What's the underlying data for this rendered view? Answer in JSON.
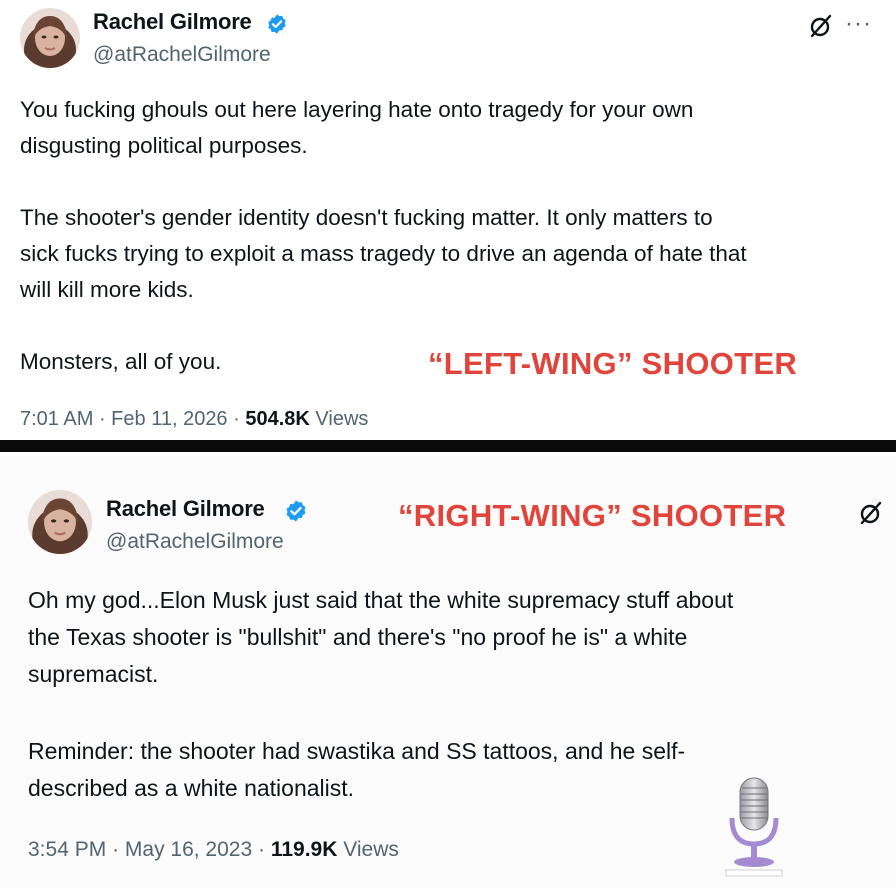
{
  "tweet_top": {
    "author_name": "Rachel Gilmore",
    "handle": "@atRachelGilmore",
    "paragraphs": [
      "You fucking ghouls out here layering hate onto tragedy for your own\ndisgusting political purposes.",
      "The shooter's gender identity doesn't fucking matter. It only matters to\nsick fucks trying to exploit a mass tragedy to drive an agenda of hate that\nwill kill more kids.",
      "Monsters, all of you."
    ],
    "time": "7:01 AM",
    "date": "Feb 11, 2026",
    "views_count": "504.8K",
    "views_label": "Views",
    "overlay_label": "“LEFT-WING” SHOOTER",
    "more_glyph": "···"
  },
  "tweet_bottom": {
    "author_name": "Rachel Gilmore",
    "handle": "@atRachelGilmore",
    "paragraphs": [
      "Oh my god...Elon Musk just said that the white supremacy stuff about\nthe Texas shooter is \"bullshit\" and there's \"no proof he is\" a white\nsupremacist.",
      "Reminder: the shooter had swastika and SS tattoos, and he self-\ndescribed as a white nationalist."
    ],
    "time": "3:54 PM",
    "date": "May 16, 2023",
    "views_count": "119.9K",
    "views_label": "Views",
    "overlay_label": "“RIGHT-WING” SHOOTER"
  },
  "colors": {
    "verified_blue": "#1d9bf0",
    "overlay_red": "#e0443a",
    "secondary_text": "#536471",
    "primary_text": "#0f1419",
    "divider": "#0b0b0b"
  },
  "icons": [
    "verified-badge-icon",
    "grok-icon",
    "more-options-icon",
    "microphone-logo-icon"
  ]
}
